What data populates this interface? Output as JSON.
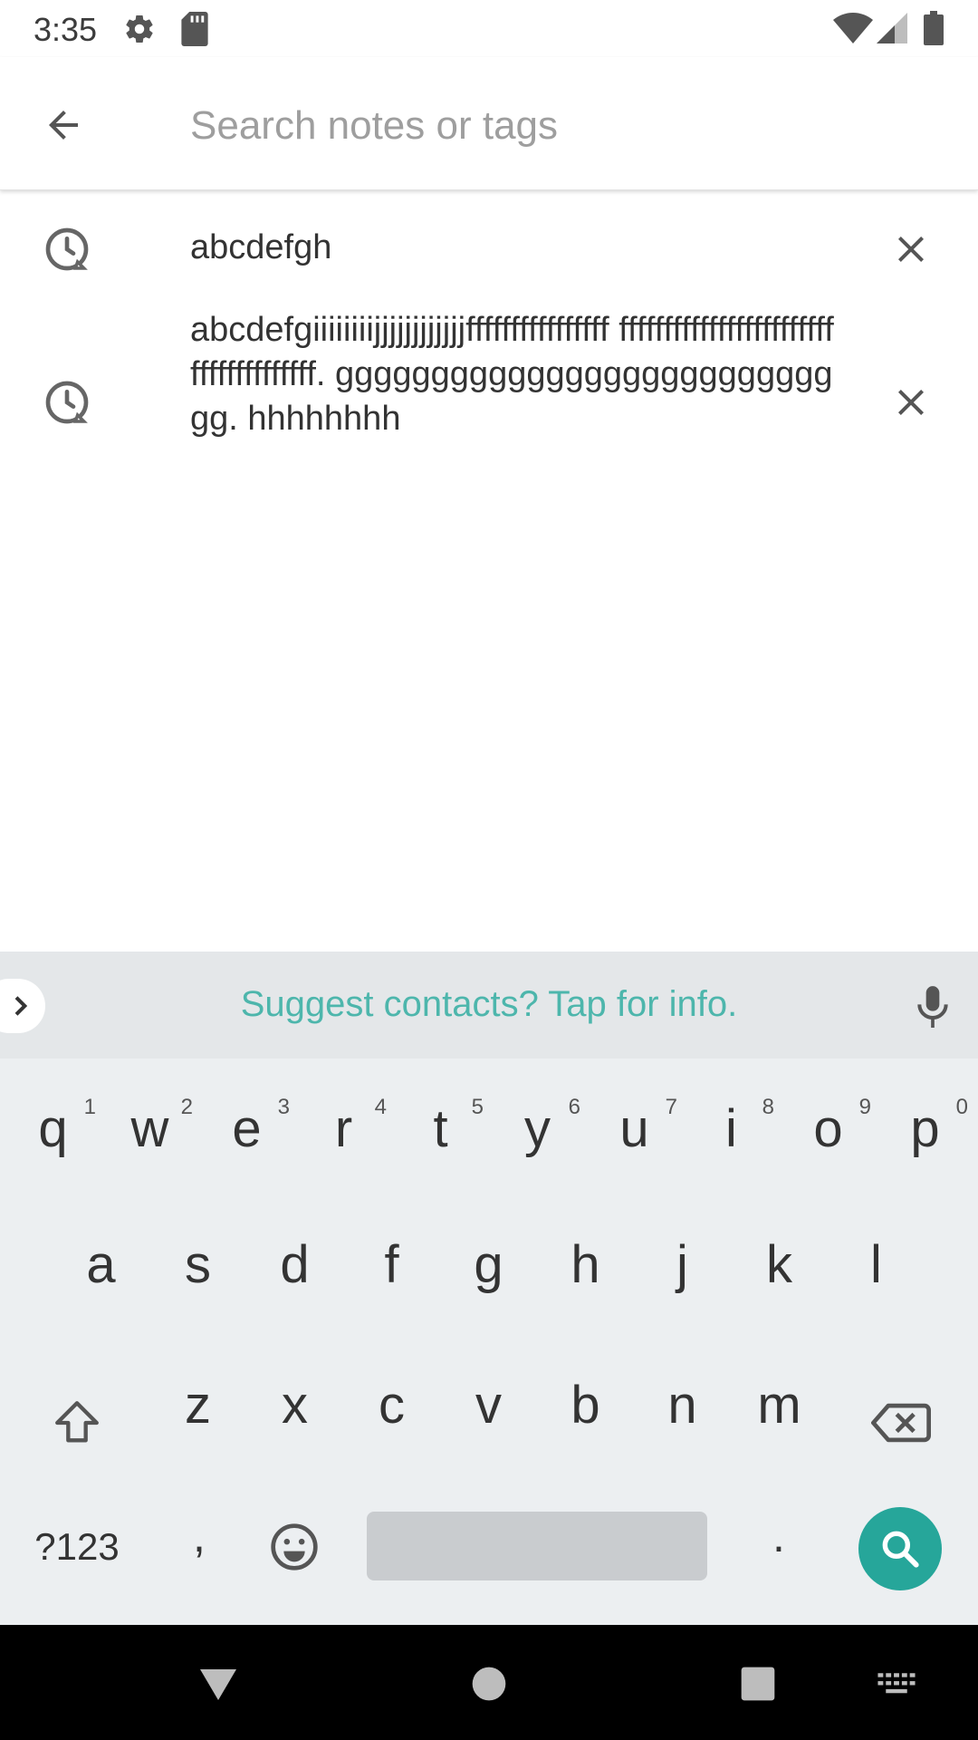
{
  "status_bar": {
    "time": "3:35"
  },
  "search": {
    "placeholder": "Search notes or tags",
    "value": ""
  },
  "history": [
    {
      "text": "abcdefgh"
    },
    {
      "text": "abcdefgiiiiiiiijjjjjjjjjjjjffffffffffffffff ffffffffffffffffffffffffffffffffffffff. gggggggggggggggggggggggggggg. hhhhhhhh"
    }
  ],
  "keyboard": {
    "suggestion": "Suggest contacts? Tap for info.",
    "row1": [
      {
        "key": "q",
        "hint": "1"
      },
      {
        "key": "w",
        "hint": "2"
      },
      {
        "key": "e",
        "hint": "3"
      },
      {
        "key": "r",
        "hint": "4"
      },
      {
        "key": "t",
        "hint": "5"
      },
      {
        "key": "y",
        "hint": "6"
      },
      {
        "key": "u",
        "hint": "7"
      },
      {
        "key": "i",
        "hint": "8"
      },
      {
        "key": "o",
        "hint": "9"
      },
      {
        "key": "p",
        "hint": "0"
      }
    ],
    "row2": [
      "a",
      "s",
      "d",
      "f",
      "g",
      "h",
      "j",
      "k",
      "l"
    ],
    "row3": [
      "z",
      "x",
      "c",
      "v",
      "b",
      "n",
      "m"
    ],
    "symbols_label": "?123",
    "comma": ",",
    "period": ".",
    "accent_color": "#26a69a",
    "suggestion_color": "#4db6ac"
  },
  "icons": {
    "back": "arrow-left-icon",
    "history": "history-icon",
    "remove": "close-icon",
    "mic": "mic-icon",
    "shift": "shift-icon",
    "backspace": "backspace-icon",
    "emoji": "emoji-icon",
    "search": "search-icon"
  }
}
